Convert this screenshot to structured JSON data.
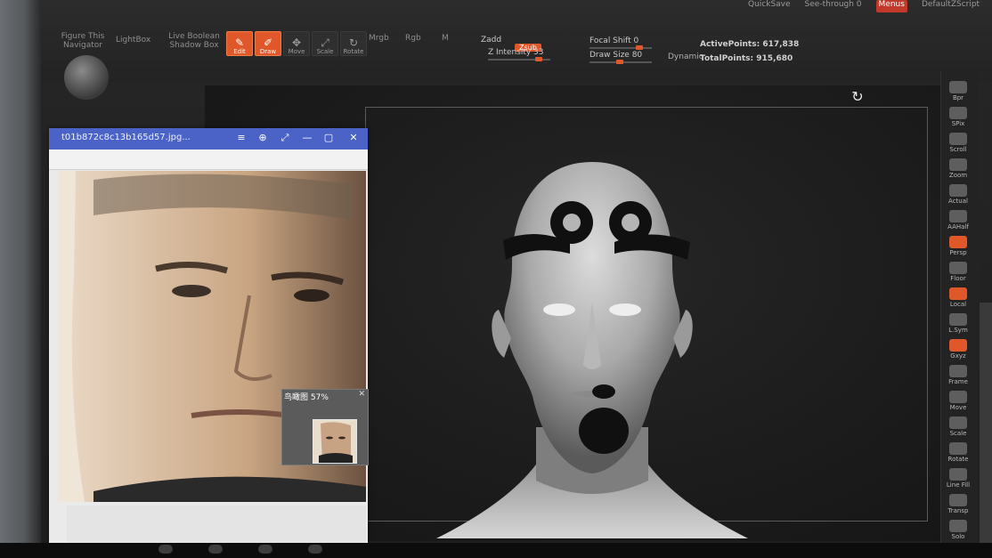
{
  "menubar": {
    "items": [
      "QuickSave",
      "See-through   0",
      "Menus",
      "DefaultZScript"
    ]
  },
  "toolbar": {
    "left_labels": [
      "Figure This",
      "Navigator",
      "LightBox",
      "Live Boolean",
      "Shadow Box"
    ],
    "tiles": [
      {
        "label": "Edit",
        "glyph": "✎",
        "on": true
      },
      {
        "label": "Draw",
        "glyph": "✐",
        "on": true
      },
      {
        "label": "Move",
        "glyph": "✥",
        "on": false
      },
      {
        "label": "Scale",
        "glyph": "⤢",
        "on": false
      },
      {
        "label": "Rotate",
        "glyph": "↻",
        "on": false
      }
    ],
    "mrgb": "Mrgb",
    "rgb": "Rgb",
    "m": "M",
    "zadd": "Zadd",
    "zsub": "Zsub",
    "z_intensity": "Z Intensity 33",
    "focal_shift": "Focal Shift 0",
    "draw_size": "Draw Size 80",
    "dynamic": "Dynamic",
    "active_points": "ActivePoints: 617,838",
    "total_points": "TotalPoints: 915,680",
    "z_intensity_value": 33,
    "focal_shift_value": 0,
    "draw_size_value": 80
  },
  "viewer": {
    "title": "t01b872c8c13b165d57.jpg...",
    "controls": [
      "≡",
      "⊕",
      "⤢",
      "—",
      "▢",
      "✕"
    ],
    "navigator_label": "鸟瞰图 57%",
    "navigator_close": "✕"
  },
  "shelf": {
    "items": [
      {
        "label": "Bpr",
        "on": false
      },
      {
        "label": "SPix",
        "on": false
      },
      {
        "label": "Scroll",
        "on": false
      },
      {
        "label": "Zoom",
        "on": false
      },
      {
        "label": "Actual",
        "on": false
      },
      {
        "label": "AAHalf",
        "on": false
      },
      {
        "label": "Persp",
        "on": true
      },
      {
        "label": "Floor",
        "on": false
      },
      {
        "label": "Local",
        "on": true
      },
      {
        "label": "L.Sym",
        "on": false
      },
      {
        "label": "Gxyz",
        "on": true
      },
      {
        "label": "Frame",
        "on": false
      },
      {
        "label": "Move",
        "on": false
      },
      {
        "label": "Scale",
        "on": false
      },
      {
        "label": "Rotate",
        "on": false
      },
      {
        "label": "Line Fill",
        "on": false
      },
      {
        "label": "Transp",
        "on": false
      },
      {
        "label": "Solo",
        "on": false
      }
    ]
  },
  "colors": {
    "accent": "#e0582a",
    "viewer_title": "#4b63c6"
  }
}
